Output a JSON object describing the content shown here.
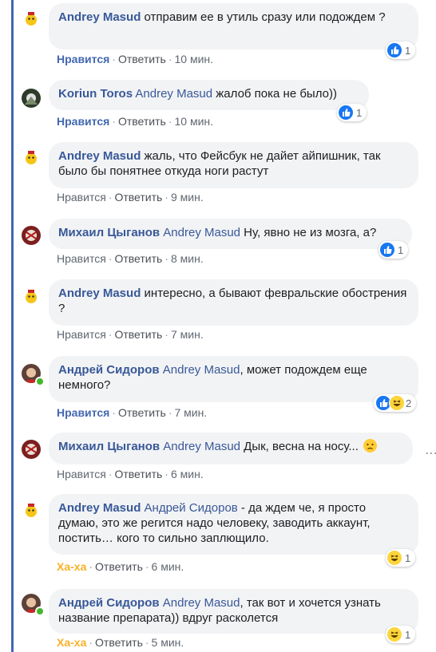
{
  "comments": [
    {
      "author": "Andrey Masud",
      "mention": "",
      "text": " отправим ее в утиль сразу или подождем ?",
      "like_label": "Нравится",
      "like_active": true,
      "reply_label": "Ответить",
      "time": "10 мин.",
      "reaction_count": "1"
    },
    {
      "author": "Koriun Toros",
      "mention": "Andrey Masud",
      "text": " жалоб пока не было))",
      "like_label": "Нравится",
      "like_active": true,
      "reply_label": "Ответить",
      "time": "10 мин.",
      "reaction_count": "1"
    },
    {
      "author": "Andrey Masud",
      "mention": "",
      "text": " жаль, что Фейсбук не дайет айпишник, так было бы понятнее откуда ноги растут",
      "like_label": "Нравится",
      "like_active": false,
      "reply_label": "Ответить",
      "time": "9 мин.",
      "reaction_count": ""
    },
    {
      "author": "Михаил Цыганов",
      "mention": "Andrey Masud",
      "text": " Ну, явно не из мозга, а?",
      "like_label": "Нравится",
      "like_active": false,
      "reply_label": "Ответить",
      "time": "8 мин.",
      "reaction_count": "1"
    },
    {
      "author": "Andrey Masud",
      "mention": "",
      "text": " интересно, а бывают февральские обострения ?",
      "like_label": "Нравится",
      "like_active": false,
      "reply_label": "Ответить",
      "time": "7 мин.",
      "reaction_count": ""
    },
    {
      "author": "Андрей Сидоров",
      "mention": "Andrey Masud",
      "text": ", может подождем еще немного?",
      "like_label": "Нравится",
      "like_active": true,
      "reply_label": "Ответить",
      "time": "7 мин.",
      "reaction_count": "2"
    },
    {
      "author": "Михаил Цыганов",
      "mention": "Andrey Masud",
      "text": " Дык, весна на носу...",
      "like_label": "Нравится",
      "like_active": false,
      "reply_label": "Ответить",
      "time": "6 мин.",
      "reaction_count": ""
    },
    {
      "author": "Andrey Masud",
      "mention": "Андрей Сидоров",
      "text": " - да ждем че, я просто думаю, это же регится надо человеку, заводить аккаунт, постить… кого то сильно заплющило.",
      "like_label": "Ха-ха",
      "like_active": false,
      "reply_label": "Ответить",
      "time": "6 мин.",
      "reaction_count": "1"
    },
    {
      "author": "Андрей Сидоров",
      "mention": "Andrey Masud",
      "text": ", так вот и хочется узнать название препарата)) вдруг расколется",
      "like_label": "Ха-ха",
      "like_active": false,
      "reply_label": "Ответить",
      "time": "5 мин.",
      "reaction_count": "1"
    }
  ],
  "separator": "·",
  "colors": {
    "link_blue": "#385898",
    "like_active": "#4267b2",
    "haha_yellow": "#f7b125",
    "bubble_bg": "#f2f3f5"
  }
}
